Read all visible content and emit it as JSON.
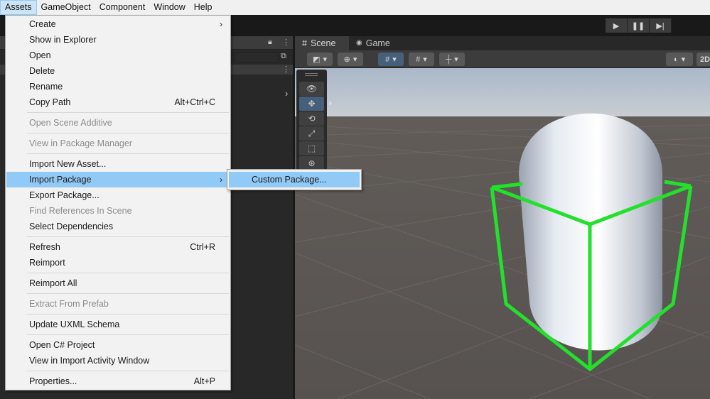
{
  "menubar": {
    "items": [
      "Assets",
      "GameObject",
      "Component",
      "Window",
      "Help"
    ],
    "active": "Assets"
  },
  "scene": {
    "tabs": [
      {
        "label": "Scene",
        "icon": "grid-icon"
      },
      {
        "label": "Game",
        "icon": "gamepad-icon"
      }
    ],
    "toolbar_2d": "2D"
  },
  "assets_menu": {
    "items": [
      {
        "label": "Create",
        "submenu": true
      },
      {
        "label": "Show in Explorer"
      },
      {
        "label": "Open"
      },
      {
        "label": "Delete"
      },
      {
        "label": "Rename"
      },
      {
        "label": "Copy Path",
        "shortcut": "Alt+Ctrl+C"
      },
      {
        "label": "Open Scene Additive",
        "disabled": true
      },
      {
        "label": "View in Package Manager",
        "disabled": true
      },
      {
        "label": "Import New Asset..."
      },
      {
        "label": "Import Package",
        "submenu": true,
        "highlighted": true
      },
      {
        "label": "Export Package..."
      },
      {
        "label": "Find References In Scene",
        "disabled": true
      },
      {
        "label": "Select Dependencies"
      },
      {
        "label": "Refresh",
        "shortcut": "Ctrl+R"
      },
      {
        "label": "Reimport"
      },
      {
        "label": "Reimport All"
      },
      {
        "label": "Extract From Prefab",
        "disabled": true
      },
      {
        "label": "Update UXML Schema"
      },
      {
        "label": "Open C# Project"
      },
      {
        "label": "View in Import Activity Window"
      },
      {
        "label": "Properties...",
        "shortcut": "Alt+P"
      }
    ]
  },
  "import_package_submenu": {
    "items": [
      "Custom Package..."
    ]
  },
  "colors": {
    "menu_highlight": "#91c9f7",
    "selection_outline": "#22e02c",
    "sky_top": "#aeb9c8",
    "ground": "#5b5550"
  }
}
